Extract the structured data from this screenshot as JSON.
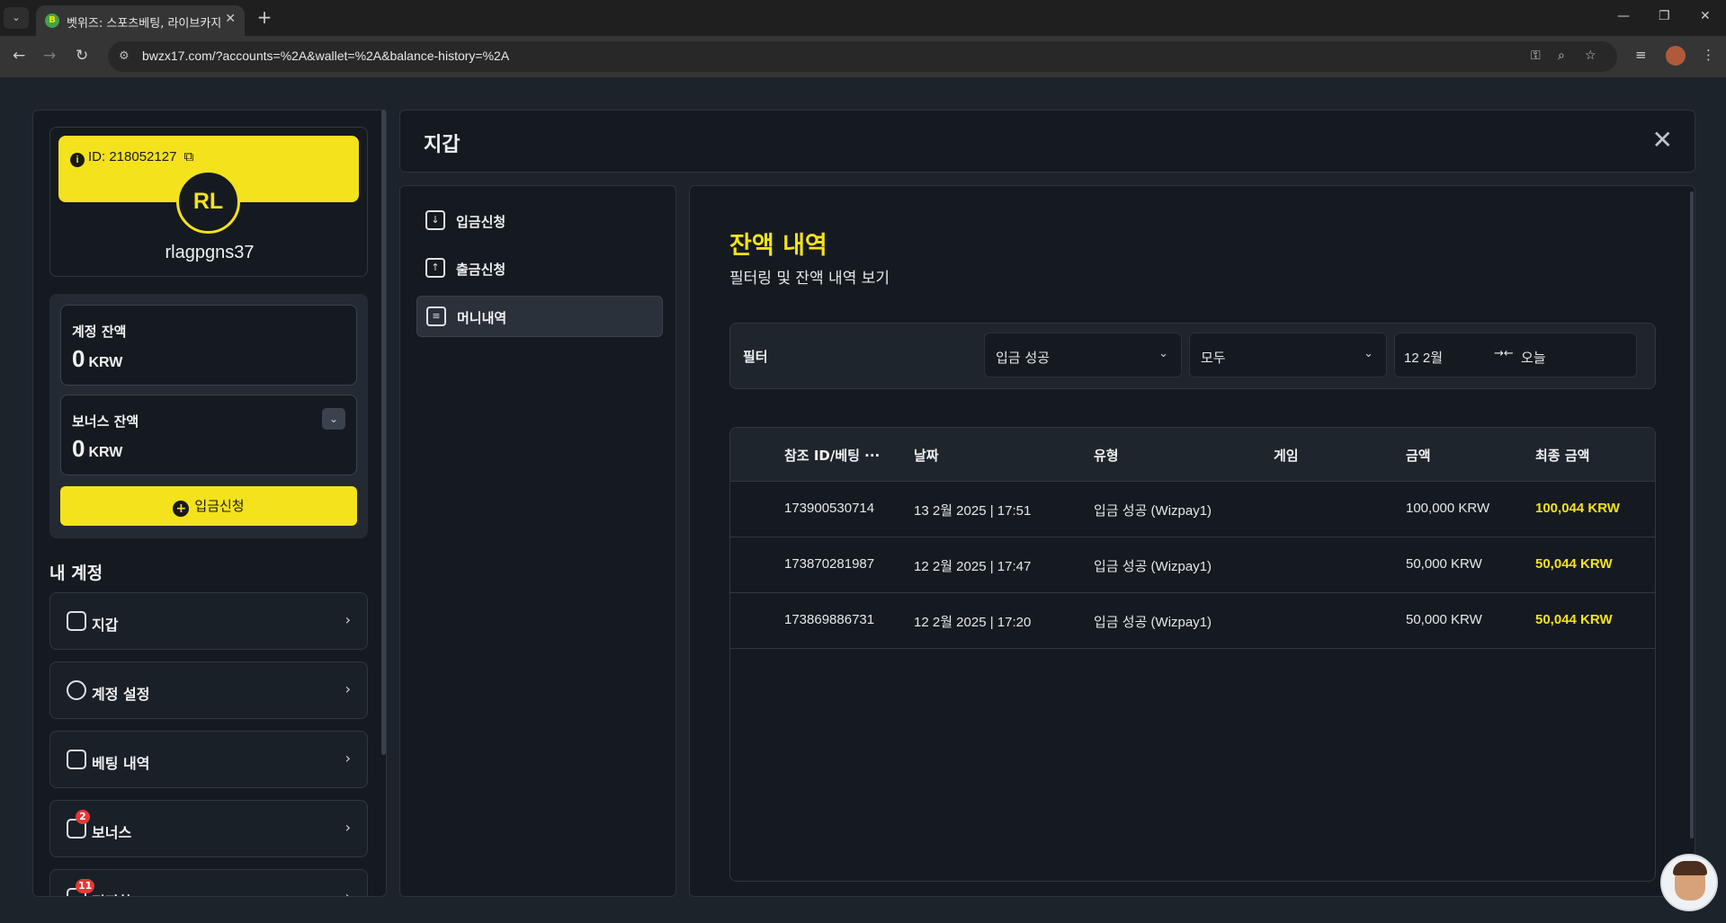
{
  "browser": {
    "tab_title": "벳위즈: 스포츠베팅, 라이브카지",
    "favicon_letter": "B",
    "url": "bwzx17.com/?accounts=%2A&wallet=%2A&balance-history=%2A"
  },
  "profile": {
    "id_label": "ID: 218052127",
    "initials": "RL",
    "username": "rlagpgns37"
  },
  "balances": {
    "account_label": "계정 잔액",
    "account_value": "0",
    "account_currency": "KRW",
    "bonus_label": "보너스 잔액",
    "bonus_value": "0",
    "bonus_currency": "KRW",
    "deposit_button": "입금신청"
  },
  "my_account": {
    "title": "내 계정",
    "items": [
      {
        "label": "지갑",
        "icon": "wallet-icon"
      },
      {
        "label": "계정 설정",
        "icon": "user-settings-icon"
      },
      {
        "label": "베팅 내역",
        "icon": "receipt-icon"
      },
      {
        "label": "보너스",
        "icon": "gift-icon",
        "badge": "2"
      },
      {
        "label": "편지함",
        "icon": "mail-icon",
        "badge": "11"
      }
    ]
  },
  "wallet": {
    "title": "지갑",
    "nav": [
      {
        "label": "입금신청",
        "icon": "download-icon"
      },
      {
        "label": "출금신청",
        "icon": "upload-icon"
      },
      {
        "label": "머니내역",
        "icon": "document-icon",
        "active": true
      }
    ]
  },
  "history": {
    "title": "잔액 내역",
    "subtitle": "필터링 및 잔액 내역 보기",
    "filter": {
      "label": "필터",
      "type_value": "입금 성공",
      "scope_value": "모두",
      "date_from": "12 2월",
      "date_to": "오늘"
    },
    "columns": [
      "참조 ID/베팅 ···",
      "날짜",
      "유형",
      "게임",
      "금액",
      "최종 금액"
    ],
    "rows": [
      {
        "ref": "173900530714",
        "date": "13 2월 2025 | 17:51",
        "type": "입금 성공 (Wizpay1)",
        "game": "",
        "amount": "100,000 KRW",
        "final": "100,044 KRW"
      },
      {
        "ref": "173870281987",
        "date": "12 2월 2025 | 17:47",
        "type": "입금 성공 (Wizpay1)",
        "game": "",
        "amount": "50,000 KRW",
        "final": "50,044 KRW"
      },
      {
        "ref": "173869886731",
        "date": "12 2월 2025 | 17:20",
        "type": "입금 성공 (Wizpay1)",
        "game": "",
        "amount": "50,000 KRW",
        "final": "50,044 KRW"
      }
    ]
  },
  "colors": {
    "accent": "#f3e21c",
    "panel": "#151a21",
    "background": "#1d232b"
  }
}
